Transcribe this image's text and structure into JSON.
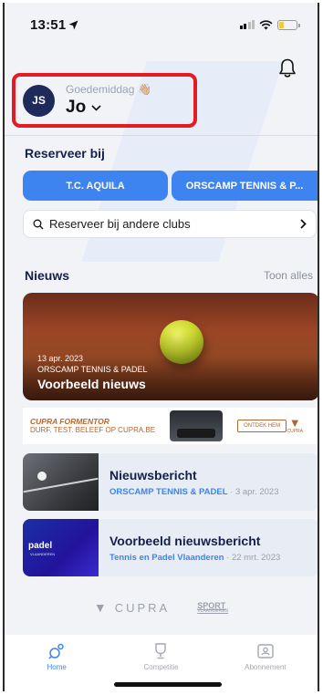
{
  "status_bar": {
    "time": "13:51"
  },
  "header": {
    "greeting": "Goedemiddag",
    "greeting_emoji": "👋🏼",
    "user_name": "Jo",
    "avatar_initials": "JS"
  },
  "reserve": {
    "title": "Reserveer bij",
    "clubs": [
      "T.C. AQUILA",
      "ORSCAMP TENNIS & P..."
    ],
    "other_clubs_label": "Reserveer bij andere clubs"
  },
  "news": {
    "title": "Nieuws",
    "show_all": "Toon alles",
    "featured": {
      "date": "13 apr. 2023",
      "club": "ORSCAMP TENNIS & PADEL",
      "title": "Voorbeeld nieuws"
    },
    "items": [
      {
        "title": "Nieuwsbericht",
        "org": "ORSCAMP TENNIS & PADEL",
        "date": "3 apr. 2023"
      },
      {
        "title": "Voorbeeld nieuwsbericht",
        "org": "Tennis en Padel Vlaanderen",
        "date": "22 mrt. 2023"
      }
    ]
  },
  "ad": {
    "brand_line": "CUPRA FORMENTOR",
    "tagline": "DURF. TEST. BELEEF OP CUPRA.BE",
    "cta": "ONTDEK HEM",
    "logo_text": "CUPRA"
  },
  "sponsors": {
    "cupra": "CUPRA",
    "sport": "SPORT",
    "sport_sub": "VLAANDEREN"
  },
  "thumb_text": {
    "padel": "padel",
    "padel_sub": "VLAANDEREN"
  },
  "tabs": [
    {
      "label": "Home",
      "icon": "home-icon",
      "active": true
    },
    {
      "label": "Competitie",
      "icon": "trophy-icon",
      "active": false
    },
    {
      "label": "Abonnement",
      "icon": "membership-card-icon",
      "active": false
    }
  ],
  "colors": {
    "accent": "#3d84f0",
    "navy": "#14204a",
    "highlight_border": "#e31b23"
  }
}
